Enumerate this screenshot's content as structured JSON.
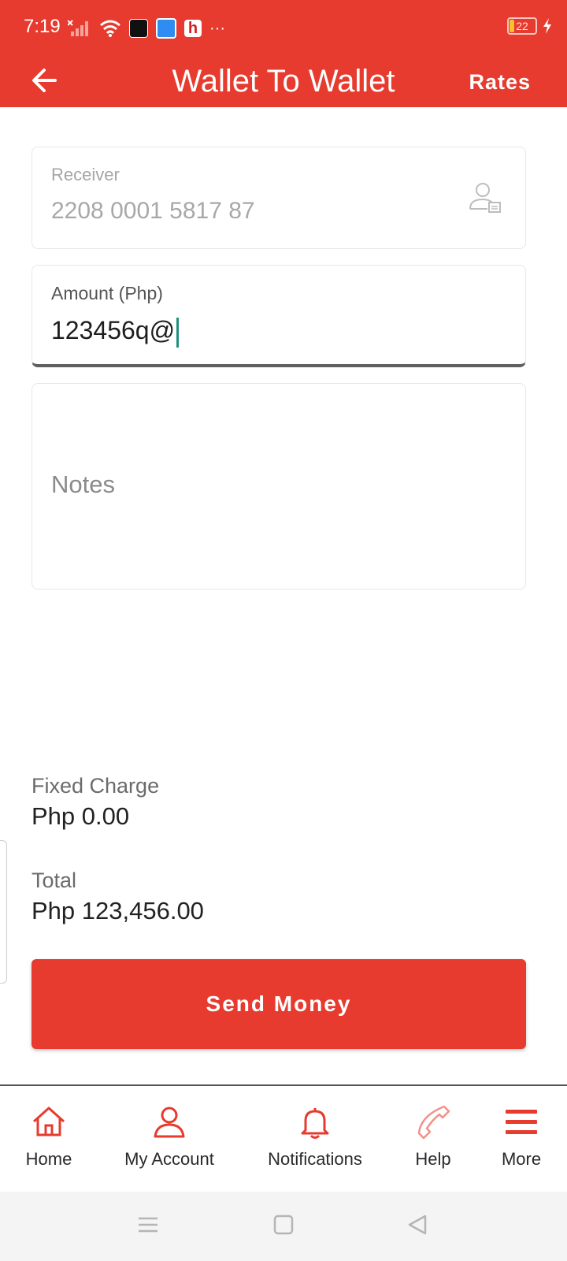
{
  "status_bar": {
    "time": "7:19",
    "more_indicator": "···",
    "battery_level": "22",
    "icons": [
      "no-signal-icon",
      "wifi-icon",
      "app-notification-icon",
      "app-notification-icon",
      "app-notification-icon",
      "battery-icon",
      "charging-icon"
    ]
  },
  "app_bar": {
    "title": "Wallet To Wallet",
    "rates_label": "Rates",
    "back_icon": "arrow-left-icon"
  },
  "form": {
    "receiver": {
      "label": "Receiver",
      "value": "2208 0001 5817 87",
      "icon": "contact-picker-icon"
    },
    "amount": {
      "label": "Amount (Php)",
      "value": "123456q@"
    },
    "notes": {
      "placeholder": "Notes"
    }
  },
  "summary": {
    "fixed_charge_label": "Fixed Charge",
    "fixed_charge_value": "Php 0.00",
    "total_label": "Total",
    "total_value": "Php 123,456.00"
  },
  "send_button": {
    "label": "Send Money"
  },
  "bottom_nav": {
    "items": [
      {
        "label": "Home",
        "icon": "home-icon"
      },
      {
        "label": "My Account",
        "icon": "user-icon"
      },
      {
        "label": "Notifications",
        "icon": "bell-icon"
      },
      {
        "label": "Help",
        "icon": "phone-icon"
      },
      {
        "label": "More",
        "icon": "menu-icon"
      }
    ]
  },
  "system_nav": {
    "icons": [
      "recent-apps-icon",
      "home-button-icon",
      "back-triangle-icon"
    ]
  },
  "colors": {
    "primary": "#e63b2e",
    "caret": "#1f8f7e",
    "text_dark": "#222222",
    "text_muted": "#a8a8a8"
  }
}
